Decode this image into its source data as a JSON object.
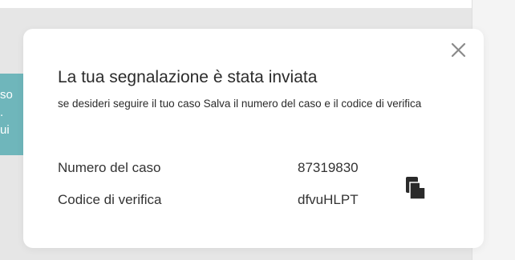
{
  "background": {
    "teal_side_texts": [
      "so",
      ".",
      "ui"
    ]
  },
  "modal": {
    "title": "La tua segnalazione è stata inviata",
    "subtitle": "se desideri seguire il tuo caso Salva il numero del caso e il codice di verifica",
    "fields": [
      {
        "label": "Numero del caso",
        "value": "87319830"
      },
      {
        "label": "Codice di verifica",
        "value": "dfvuHLPT"
      }
    ],
    "close_icon": "close-icon",
    "copy_icon": "copy-icon"
  },
  "colors": {
    "backdrop": "#e6e6e6",
    "teal": "#6fb6bb",
    "text": "#2b2b2b",
    "icon": "#2a2a2a",
    "close_icon": "#8a8a8a"
  }
}
